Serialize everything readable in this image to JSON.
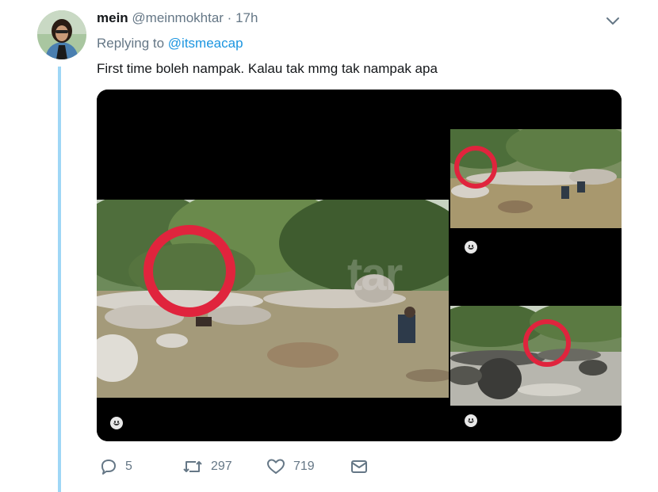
{
  "tweet": {
    "display_name": "mein",
    "handle": "@meinmokhtar",
    "separator": "·",
    "time": "17h",
    "replying_to_label": "Replying to",
    "replying_to_handle": "@itsmeacap",
    "text": "First time boleh nampak. Kalau tak mmg tak nampak apa"
  },
  "media": {
    "watermark": "tar",
    "circle_color": "#e0243d"
  },
  "actions": {
    "reply_count": "5",
    "retweet_count": "297",
    "like_count": "719"
  },
  "colors": {
    "link": "#1b95e0",
    "secondary_text": "#657786",
    "thread_line": "#9fd7f6"
  }
}
